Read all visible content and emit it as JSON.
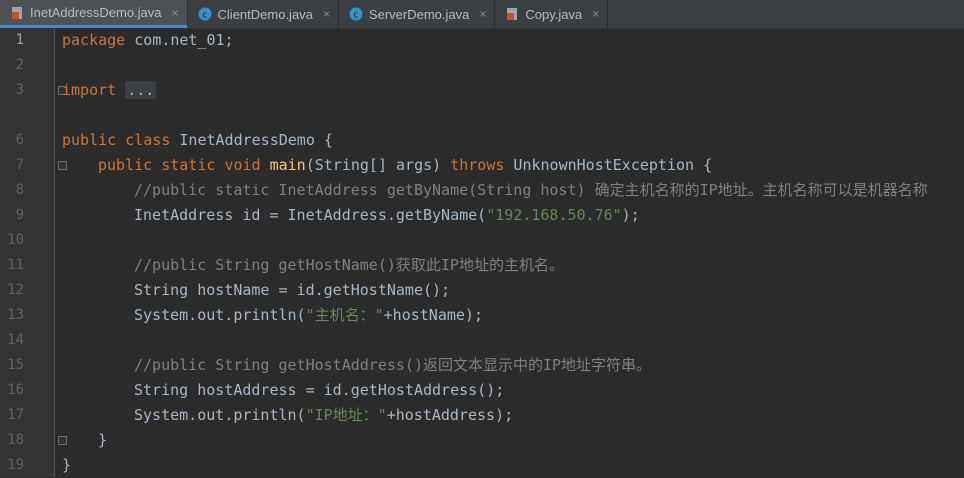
{
  "tabs": [
    {
      "label": "InetAddressDemo.java",
      "icon": "java-file-icon",
      "active": true
    },
    {
      "label": "ClientDemo.java",
      "icon": "class-c-icon",
      "active": false
    },
    {
      "label": "ServerDemo.java",
      "icon": "class-c-icon",
      "active": false
    },
    {
      "label": "Copy.java",
      "icon": "java-file-icon",
      "active": false
    }
  ],
  "close_glyph": "×",
  "line_numbers": [
    "1",
    "2",
    "3",
    "6",
    "7",
    "8",
    "9",
    "10",
    "11",
    "12",
    "13",
    "14",
    "15",
    "16",
    "17",
    "18",
    "19"
  ],
  "code": {
    "l1": {
      "kw": "package",
      "rest": " com.net_01;"
    },
    "l3": {
      "kw": "import",
      "folded": "..."
    },
    "l6": {
      "kw1": "public",
      "kw2": "class",
      "rest": " InetAddressDemo {"
    },
    "l7": {
      "kw1": "public",
      "kw2": "static",
      "kw3": "void",
      "fn": "main",
      "mid": "(String[] args) ",
      "kw4": "throws",
      "rest": " UnknownHostException {"
    },
    "l8": {
      "comment": "//public static InetAddress getByName(String host) 确定主机名称的IP地址。主机名称可以是机器名称"
    },
    "l9": {
      "pre": "InetAddress id = InetAddress.getByName(",
      "str": "\"192.168.50.76\"",
      "post": ");"
    },
    "l11": {
      "comment": "//public String getHostName()获取此IP地址的主机名。"
    },
    "l12": {
      "pre": "String hostName = id.getHostName();"
    },
    "l13": {
      "pre": "System.out.println(",
      "str": "\"主机名：\"",
      "post": "+hostName);"
    },
    "l15": {
      "comment": "//public String getHostAddress()返回文本显示中的IP地址字符串。"
    },
    "l16": {
      "pre": "String hostAddress = id.getHostAddress();"
    },
    "l17": {
      "pre": "System.out.println(",
      "str": "\"IP地址：\"",
      "post": "+hostAddress);"
    },
    "l18": {
      "pre": "}"
    },
    "l19": {
      "pre": "}"
    }
  },
  "colors": {
    "keyword": "#cc7832",
    "string": "#6a8759",
    "comment": "#808080",
    "method": "#ffc66d",
    "text": "#a9b7c6",
    "background": "#2b2b2b"
  }
}
